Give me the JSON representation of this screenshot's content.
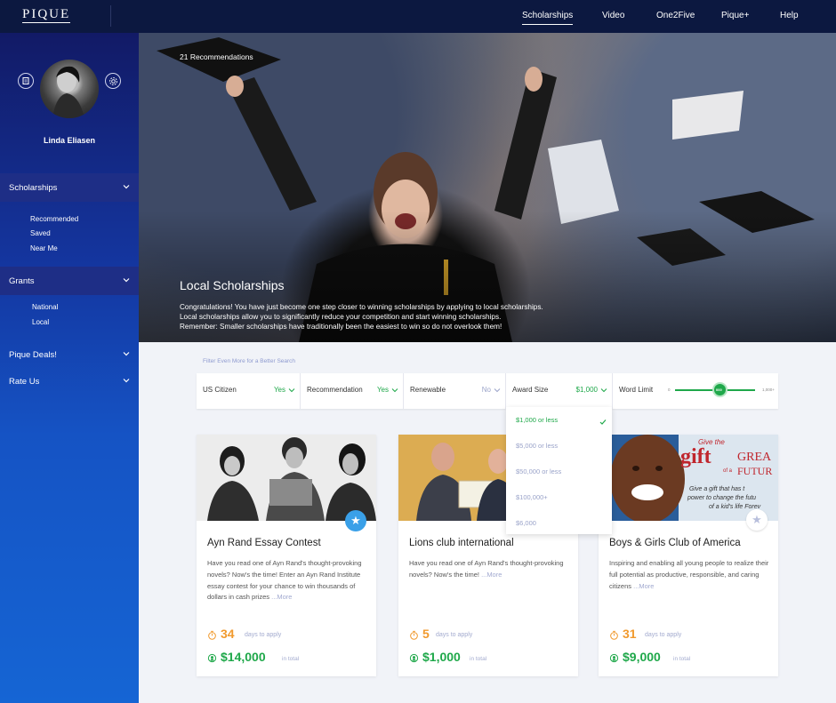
{
  "app": {
    "logo": "PIQUE"
  },
  "nav": [
    {
      "label": "Scholarships",
      "active": true
    },
    {
      "label": "Video"
    },
    {
      "label": "One2Five"
    },
    {
      "label": "Pique+"
    },
    {
      "label": "Help"
    }
  ],
  "user": {
    "name": "Linda Eliasen"
  },
  "sidebar": {
    "scholarships": {
      "label": "Scholarships",
      "items": [
        "Recommended",
        "Saved",
        "Near Me"
      ]
    },
    "grants": {
      "label": "Grants",
      "items": [
        "National",
        "Local"
      ]
    },
    "deals": {
      "label": "Pique Deals!"
    },
    "rate": {
      "label": "Rate Us"
    }
  },
  "hero": {
    "count": "21 Recommendations",
    "title": "Local Scholarships",
    "desc1": "Congratulations! You have just become one step closer to winning scholarships by applying to local scholarships.",
    "desc2": "Local scholarships allow you to significantly reduce your competition and start winning scholarships.",
    "desc3": "Remember: Smaller scholarships have traditionally been the easiest to win so do not overlook them!"
  },
  "filter": {
    "caption": "Filter Even More for a Better Search",
    "us_citizen": {
      "label": "US Citizen",
      "value": "Yes"
    },
    "recommendation": {
      "label": "Recommendation",
      "value": "Yes"
    },
    "renewable": {
      "label": "Renewable",
      "value": "No"
    },
    "award_size": {
      "label": "Award Size",
      "value": "$1,000"
    },
    "word_limit": {
      "label": "Word Limit",
      "min": "0",
      "max": "1,000+",
      "knob": "000",
      "level": 0.55
    },
    "award_options": [
      "$1,000 or less",
      "$5,000 or less",
      "$50,000 or less",
      "$100,000+",
      "$6,000"
    ],
    "selected_index": 0
  },
  "labels": {
    "days": "days to apply",
    "total": "in total",
    "more": "...More"
  },
  "cards": [
    {
      "title": "Ayn Rand Essay Contest",
      "desc": "Have you read one of Ayn Rand's thought-provoking novels? Now's the time! Enter an Ayn Rand Institute essay contest for your chance to win thousands of dollars in cash prizes",
      "days": "34",
      "amount": "$14,000",
      "starred": true
    },
    {
      "title": "Lions club international",
      "desc": "Have you read one of Ayn Rand's thought-provoking novels? Now's the time!",
      "days": "5",
      "amount": "$1,000",
      "starred": false
    },
    {
      "title": "Boys & Girls Club of America",
      "desc": "Inspiring and enabling all young people to realize their full potential as productive, responsible, and caring citizens",
      "days": "31",
      "amount": "$9,000",
      "starred": false,
      "banner": {
        "line1": "Give the",
        "gift": "gift",
        "great": "GREA",
        "of_a": "of a",
        "future": "FUTUR",
        "sub1": "Give a gift that has t",
        "sub2": "power to change the futu",
        "sub3": "of a kid's life Forev"
      }
    }
  ],
  "colors": {
    "accent_green": "#1fa84a",
    "accent_orange": "#f19a2e",
    "nav_bg": "#0c1840",
    "star_blue": "#3aa0e8"
  }
}
